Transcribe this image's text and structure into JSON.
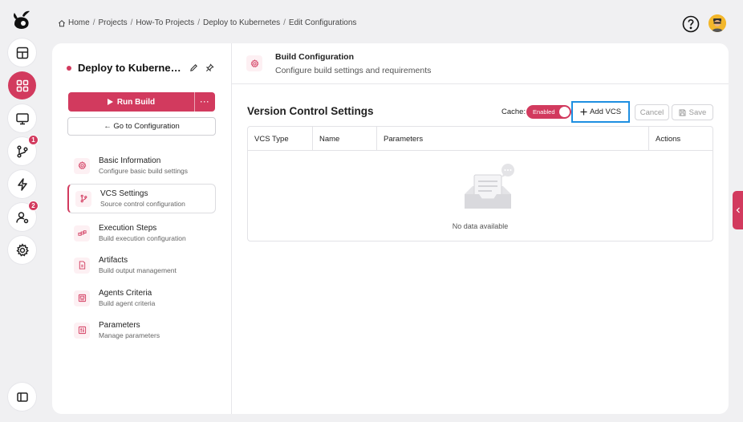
{
  "breadcrumb": {
    "items": [
      "Home",
      "Projects",
      "How-To Projects",
      "Deploy to Kubernetes",
      "Edit Configurations"
    ],
    "separator": "/"
  },
  "rail": {
    "badges": {
      "vcs": "1",
      "users": "2"
    }
  },
  "project": {
    "name": "Deploy to Kubernetes",
    "run_build_label": "Run Build",
    "more_label": "···",
    "goto_label": "← Go to Configuration"
  },
  "nav": [
    {
      "label": "Basic Information",
      "sub": "Configure basic build settings",
      "icon": "gear-icon"
    },
    {
      "label": "VCS Settings",
      "sub": "Source control configuration",
      "icon": "branch-icon"
    },
    {
      "label": "Execution Steps",
      "sub": "Build execution configuration",
      "icon": "steps-icon"
    },
    {
      "label": "Artifacts",
      "sub": "Build output management",
      "icon": "file-icon"
    },
    {
      "label": "Agents Criteria",
      "sub": "Build agent criteria",
      "icon": "agent-icon"
    },
    {
      "label": "Parameters",
      "sub": "Manage parameters",
      "icon": "sliders-icon"
    }
  ],
  "section": {
    "title": "Build Configuration",
    "subtitle": "Configure build settings and requirements"
  },
  "vcs": {
    "title": "Version Control Settings",
    "cache_label": "Cache:",
    "cache_state": "Enabled",
    "add_label": "Add VCS",
    "cancel_label": "Cancel",
    "save_label": "Save",
    "columns": [
      "VCS Type",
      "Name",
      "Parameters",
      "Actions"
    ],
    "empty_text": "No data available"
  },
  "colors": {
    "accent": "#d23a5e",
    "focus_outline": "#1e8fe1"
  }
}
